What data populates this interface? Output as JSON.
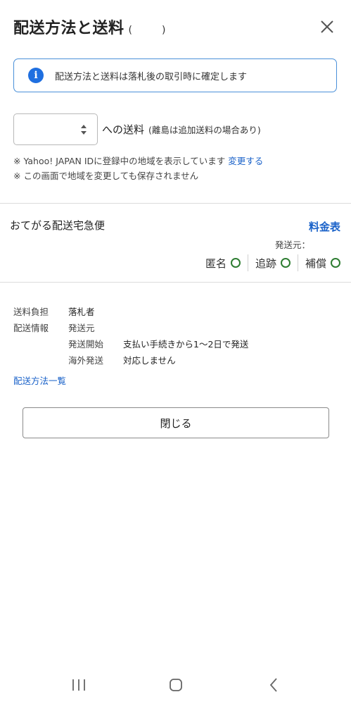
{
  "header": {
    "title": "配送方法と送料",
    "title_paren": "(　　　)",
    "close_icon": "close-icon"
  },
  "notice": {
    "icon": "info-icon",
    "icon_glyph": "i",
    "text": "配送方法と送料は落札後の取引時に確定します"
  },
  "region": {
    "selected_value": "",
    "label": "への送料",
    "note": "(離島は追加送料の場合あり)"
  },
  "notes": {
    "line1_prefix": "※ Yahoo! JAPAN IDに登録中の地域を表示しています",
    "line1_link": "変更する",
    "line2": "※ この画面で地域を変更しても保存されません"
  },
  "shipping": {
    "carrier": "おてがる配送宅急便",
    "rate_link": "料金表",
    "origin_label": "発送元：",
    "features": [
      {
        "label": "匿名",
        "status": "available"
      },
      {
        "label": "追跡",
        "status": "available"
      },
      {
        "label": "補償",
        "status": "available"
      }
    ],
    "feature_color": "#2e7d32"
  },
  "details": {
    "burden_label": "送料負担",
    "burden_value": "落札者",
    "info_label": "配送情報",
    "origin_label": "発送元",
    "start_label": "発送開始",
    "start_value": "支払い手続きから1〜2日で発送",
    "overseas_label": "海外発送",
    "overseas_value": "対応しません",
    "methods_link": "配送方法一覧"
  },
  "close_button": "閉じる",
  "colors": {
    "link": "#1a62c9",
    "notice_border": "#4a90d9",
    "info_icon_bg": "#1f6fe0"
  },
  "navbar": {
    "items": [
      "recent-apps-icon",
      "home-icon",
      "back-icon"
    ]
  }
}
